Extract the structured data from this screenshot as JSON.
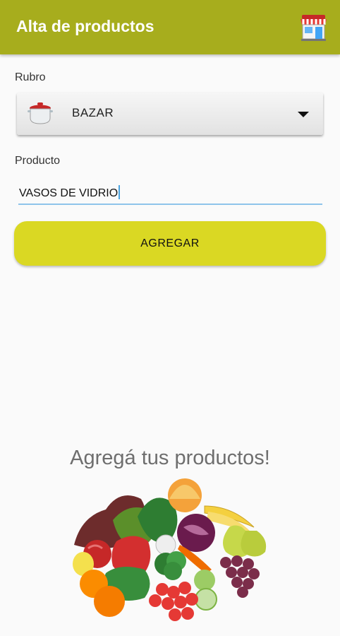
{
  "appbar": {
    "title": "Alta de productos",
    "icon": "store-icon"
  },
  "form": {
    "rubro_label": "Rubro",
    "rubro_selected": "BAZAR",
    "rubro_icon": "pot-icon",
    "producto_label": "Producto",
    "producto_value": "VASOS DE VIDRIO",
    "submit_label": "AGREGAR"
  },
  "promo": {
    "text": "Agregá tus productos!",
    "image": "vegetables-illustration"
  },
  "colors": {
    "appbar": "#a7ad1d",
    "button": "#dad823",
    "input_underline": "#8fc4ea"
  }
}
